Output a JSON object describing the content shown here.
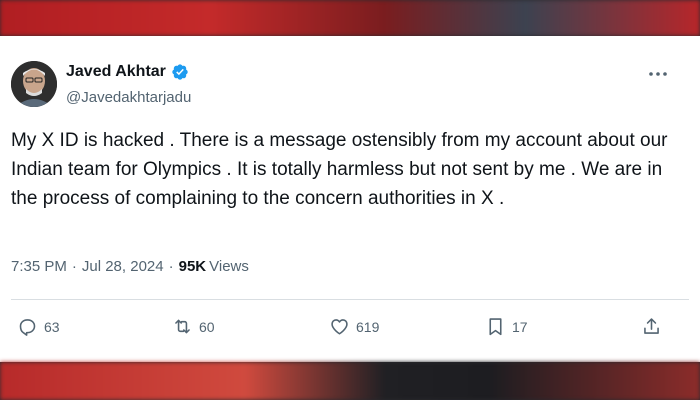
{
  "tweet": {
    "author_name": "Javed Akhtar",
    "author_handle": "@Javedakhtarjadu",
    "verified": true,
    "text": "My X ID is hacked . There is a message ostensibly from my account about our Indian team for Olympics . It is totally harmless but not sent by me . We are in the process of complaining to the concern authorities in X .",
    "time": "7:35 PM",
    "separator": "·",
    "date": "Jul 28, 2024",
    "views_count": "95K",
    "views_label": "Views"
  },
  "actions": {
    "replies": "63",
    "reposts": "60",
    "likes": "619",
    "bookmarks": "17"
  },
  "icons": {
    "verified": "verified-badge-icon",
    "more": "more-options-icon",
    "reply": "reply-icon",
    "repost": "repost-icon",
    "like": "like-icon",
    "bookmark": "bookmark-icon",
    "share": "share-icon"
  },
  "colors": {
    "text_primary": "#0f1419",
    "text_secondary": "#536471",
    "verified_blue": "#1d9bf0",
    "divider": "#d9dee2"
  }
}
